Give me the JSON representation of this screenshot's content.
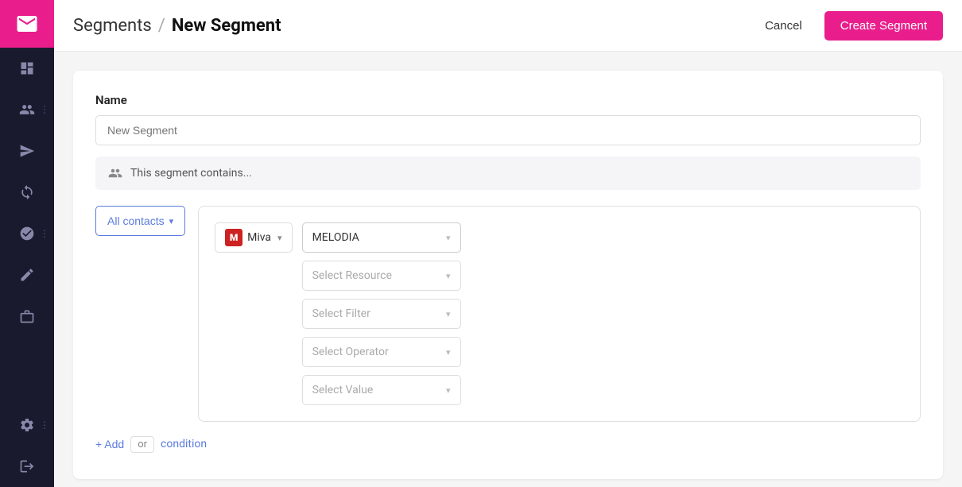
{
  "sidebar": {
    "logo_label": "Email",
    "items": [
      {
        "id": "dashboard",
        "icon": "dashboard",
        "label": "Dashboard"
      },
      {
        "id": "contacts",
        "icon": "contacts",
        "label": "Contacts",
        "has_dots": true
      },
      {
        "id": "campaigns",
        "icon": "campaigns",
        "label": "Campaigns"
      },
      {
        "id": "automations",
        "icon": "automations",
        "label": "Automations"
      },
      {
        "id": "integrations",
        "icon": "integrations",
        "label": "Integrations",
        "has_dots": true
      },
      {
        "id": "forms",
        "icon": "forms",
        "label": "Forms"
      },
      {
        "id": "products",
        "icon": "products",
        "label": "Products"
      },
      {
        "id": "settings",
        "icon": "settings",
        "label": "Settings",
        "has_dots": true
      },
      {
        "id": "logout",
        "icon": "logout",
        "label": "Logout"
      }
    ]
  },
  "header": {
    "breadcrumb_parent": "Segments",
    "breadcrumb_separator": "/",
    "breadcrumb_current": "New Segment",
    "cancel_label": "Cancel",
    "create_label": "Create Segment"
  },
  "form": {
    "name_label": "Name",
    "name_placeholder": "New Segment",
    "segment_contains_text": "This segment contains...",
    "all_contacts_label": "All contacts",
    "integration_name": "Miva",
    "integration_icon": "M",
    "selected_integration": "MELODIA",
    "dropdowns": [
      {
        "id": "resource",
        "placeholder": "Select Resource"
      },
      {
        "id": "filter",
        "placeholder": "Select Filter"
      },
      {
        "id": "operator",
        "placeholder": "Select Operator"
      },
      {
        "id": "value",
        "placeholder": "Select Value"
      }
    ],
    "add_label": "+ Add",
    "or_label": "or",
    "condition_label": "condition"
  },
  "colors": {
    "accent": "#e91e8c",
    "blue": "#5b7bde",
    "sidebar_bg": "#1a1a2e"
  }
}
